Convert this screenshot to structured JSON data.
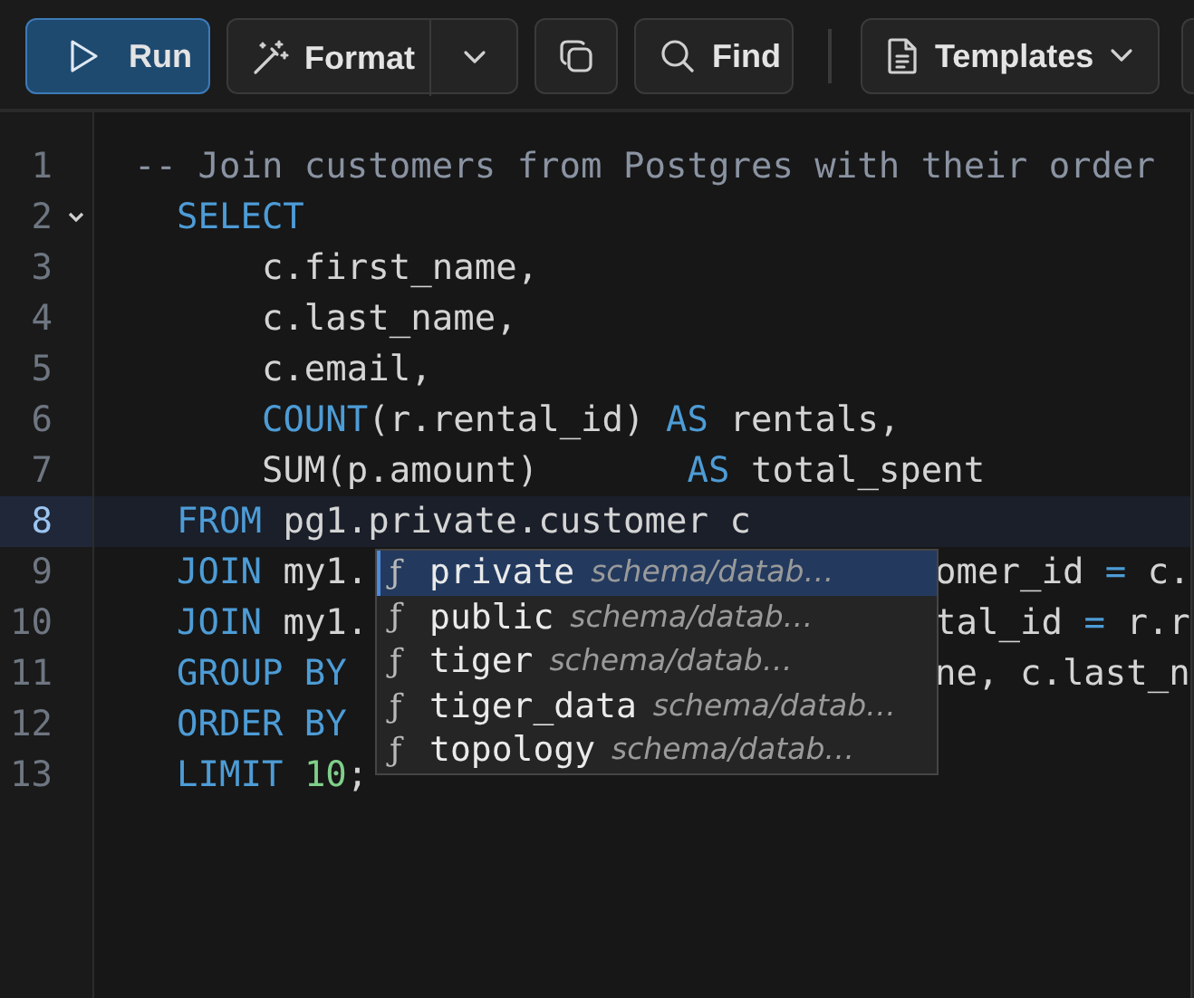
{
  "toolbar": {
    "buttons": [
      {
        "kind": "run",
        "label": "Run"
      },
      {
        "kind": "format",
        "label": "Format"
      },
      {
        "kind": "copy"
      },
      {
        "kind": "find",
        "label": "Find"
      },
      {
        "kind": "templates",
        "label": "Templates"
      },
      {
        "kind": "clipped"
      }
    ]
  },
  "editor": {
    "lines": [
      {
        "number": "1",
        "current": false,
        "tokens": [
          {
            "kind": "comment",
            "text": "-- Join customers from Postgres with their order"
          }
        ]
      },
      {
        "number": "2",
        "current": false,
        "expanded": true,
        "tokens": [
          {
            "kind": "keyword",
            "text": "  SELECT"
          }
        ]
      },
      {
        "number": "3",
        "current": false,
        "tokens": [
          {
            "kind": "text",
            "text": "      c.first_name,"
          }
        ]
      },
      {
        "number": "4",
        "current": false,
        "tokens": [
          {
            "kind": "text",
            "text": "      c.last_name,"
          }
        ]
      },
      {
        "number": "5",
        "current": false,
        "tokens": [
          {
            "kind": "text",
            "text": "      c.email,"
          }
        ]
      },
      {
        "number": "6",
        "current": false,
        "tokens": [
          {
            "kind": "keyword",
            "text": "      COUNT"
          },
          {
            "kind": "text",
            "text": "(r.rental_id) "
          },
          {
            "kind": "keyword",
            "text": "AS"
          },
          {
            "kind": "text",
            "text": " rentals,"
          }
        ]
      },
      {
        "number": "7",
        "current": false,
        "tokens": [
          {
            "kind": "text",
            "text": "      SUM(p.amount)       "
          },
          {
            "kind": "keyword",
            "text": "AS"
          },
          {
            "kind": "text",
            "text": " total_spent"
          }
        ]
      },
      {
        "number": "8",
        "current": true,
        "tokens": [
          {
            "kind": "keyword",
            "text": "  FROM"
          },
          {
            "kind": "text",
            "text": " pg1.private.customer c"
          }
        ]
      },
      {
        "number": "9",
        "current": false,
        "tokens": [
          {
            "kind": "keyword",
            "text": "  JOIN"
          },
          {
            "kind": "text",
            "text": " my1."
          }
        ],
        "tail": [
          {
            "kind": "text",
            "text": "omer_id "
          },
          {
            "kind": "operator",
            "text": "="
          },
          {
            "kind": "text",
            "text": " c."
          }
        ]
      },
      {
        "number": "10",
        "current": false,
        "tokens": [
          {
            "kind": "keyword",
            "text": "  JOIN"
          },
          {
            "kind": "text",
            "text": " my1."
          }
        ],
        "tail": [
          {
            "kind": "text",
            "text": "tal_id "
          },
          {
            "kind": "operator",
            "text": "="
          },
          {
            "kind": "text",
            "text": " r.r"
          }
        ]
      },
      {
        "number": "11",
        "current": false,
        "tokens": [
          {
            "kind": "keyword",
            "text": "  GROUP BY"
          }
        ],
        "tail": [
          {
            "kind": "text",
            "text": "ne, c.last_n"
          }
        ]
      },
      {
        "number": "12",
        "current": false,
        "tokens": [
          {
            "kind": "keyword",
            "text": "  ORDER BY"
          }
        ]
      },
      {
        "number": "13",
        "current": false,
        "tokens": [
          {
            "kind": "keyword",
            "text": "  LIMIT "
          },
          {
            "kind": "number",
            "text": "10"
          },
          {
            "kind": "text",
            "text": ";"
          }
        ]
      }
    ]
  },
  "autocomplete": {
    "items": [
      {
        "icon": "ƒ",
        "label": "private",
        "detail": "schema/datab…",
        "selected": true
      },
      {
        "icon": "ƒ",
        "label": "public",
        "detail": "schema/datab…",
        "selected": false
      },
      {
        "icon": "ƒ",
        "label": "tiger",
        "detail": "schema/datab…",
        "selected": false
      },
      {
        "icon": "ƒ",
        "label": "tiger_data",
        "detail": "schema/datab…",
        "selected": false
      },
      {
        "icon": "ƒ",
        "label": "topology",
        "detail": "schema/datab…",
        "selected": false
      }
    ]
  }
}
